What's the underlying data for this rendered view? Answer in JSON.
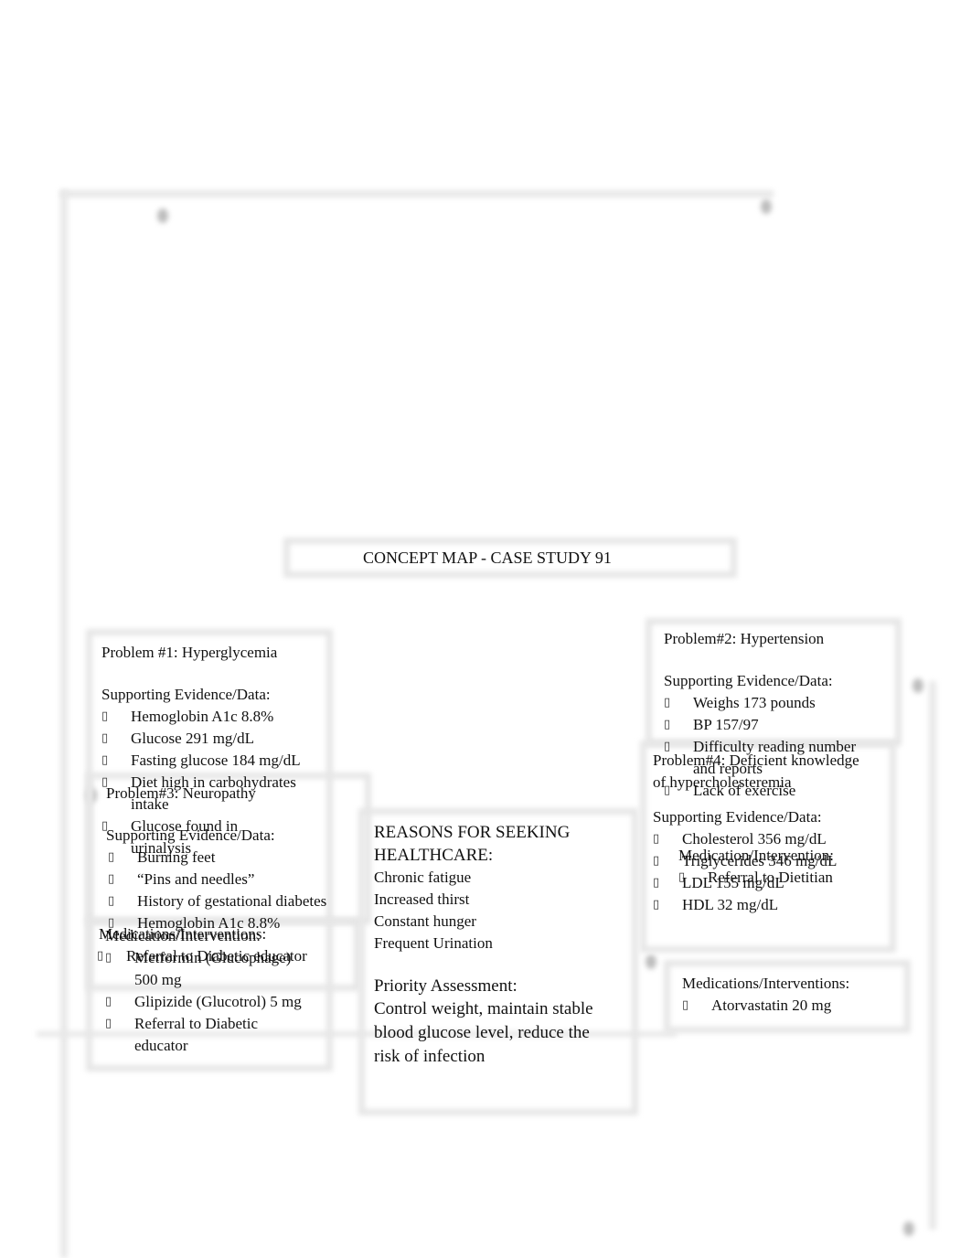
{
  "title": "CONCEPT  MAP  - CASE STUDY 91",
  "bullet_icon": "▯",
  "problem1": {
    "heading": "Problem #1: Hyperglycemia",
    "evidence_label": "Supporting Evidence/Data:",
    "evidence": [
      {
        "lines": [
          "Hemoglobin A1c 8.8%"
        ]
      },
      {
        "lines": [
          "Glucose 291 mg/dL"
        ]
      },
      {
        "lines": [
          "Fasting glucose 184 mg/dL"
        ]
      },
      {
        "lines": [
          "Diet high in carbohydrates",
          "intake"
        ]
      },
      {
        "lines": [
          "Glucose found in",
          "urinalysis"
        ]
      }
    ],
    "med_label": "Medication/Intervention:",
    "meds": [
      {
        "lines": [
          "Metformin (Glucophage)",
          "500 mg"
        ]
      },
      {
        "lines": [
          "Glipizide (Glucotrol) 5 mg"
        ]
      },
      {
        "lines": [
          "Referral to Diabetic",
          "educator"
        ]
      }
    ]
  },
  "problem3": {
    "heading": "Problem#3: Neuropathy",
    "evidence_label": "Supporting Evidence/Data:",
    "evidence": [
      {
        "lines": [
          "Burning feet"
        ]
      },
      {
        "lines": [
          "“Pins and needles”"
        ]
      },
      {
        "lines": [
          "History of gestational diabetes"
        ]
      },
      {
        "lines": [
          "Hemoglobin A1c 8.8%"
        ]
      }
    ],
    "med_label": "Medications/Interventions:",
    "meds": [
      {
        "lines": [
          "Referral to Diabetic educator"
        ]
      }
    ]
  },
  "problem2": {
    "heading": "Problem#2: Hypertension",
    "evidence_label": "Supporting Evidence/Data:",
    "evidence": [
      {
        "lines": [
          "Weighs 173 pounds"
        ]
      },
      {
        "lines": [
          "BP 157/97"
        ]
      },
      {
        "lines": [
          "Difficulty reading number",
          "and reports"
        ]
      },
      {
        "lines": [
          "Lack of exercise"
        ]
      }
    ],
    "med_label": "Medication/Intervention:",
    "meds": [
      {
        "lines": [
          "Referral to Dietitian"
        ]
      }
    ]
  },
  "problem4": {
    "heading_lines": [
      "Problem#4: Deficient knowledge",
      "of hypercholesteremia"
    ],
    "evidence_label": "Supporting Evidence/Data:",
    "evidence": [
      {
        "lines": [
          "Cholesterol 356 mg/dL"
        ]
      },
      {
        "lines": [
          "Triglycerides 346 mg/dL"
        ]
      },
      {
        "lines": [
          "LDL 155 mg/dL"
        ]
      },
      {
        "lines": [
          "HDL 32 mg/dL"
        ]
      }
    ],
    "med_label": "Medications/Interventions:",
    "meds": [
      {
        "lines": [
          "Atorvastatin 20 mg"
        ]
      }
    ]
  },
  "center": {
    "heading_lines": [
      "REASONS FOR SEEKING",
      "HEALTHCARE:"
    ],
    "reasons": [
      "Chronic fatigue",
      "Increased thirst",
      "Constant hunger",
      "Frequent Urination"
    ],
    "priority_label": "Priority Assessment:",
    "priority_lines": [
      "Control weight, maintain stable",
      "blood glucose level, reduce the",
      "risk of infection"
    ]
  }
}
